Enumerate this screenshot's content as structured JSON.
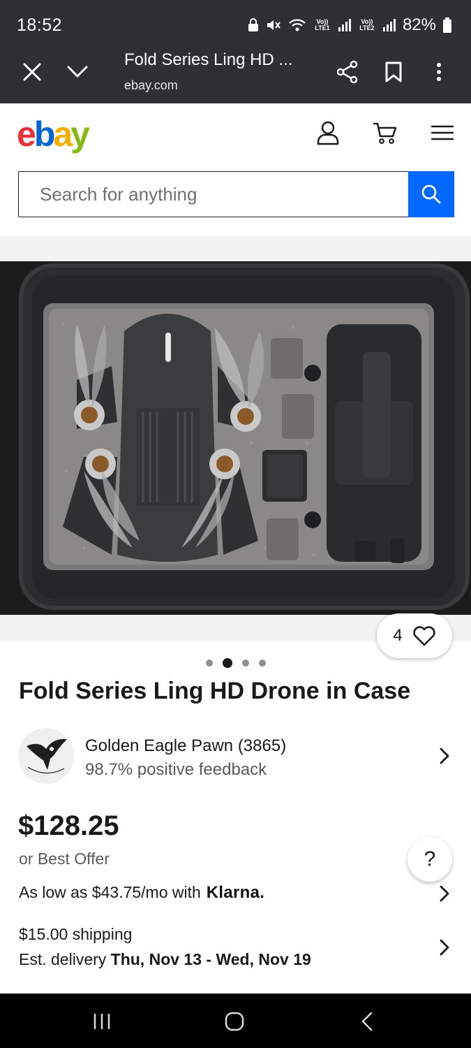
{
  "status_bar": {
    "time": "18:52",
    "network1": "Vo)) LTE1",
    "network2": "Vo)) LTE2",
    "battery": "82%"
  },
  "browser": {
    "title": "Fold Series Ling HD ...",
    "url": "ebay.com"
  },
  "header": {
    "logo": {
      "e": "e",
      "b": "b",
      "a": "a",
      "y": "y"
    },
    "search_placeholder": "Search for anything"
  },
  "item": {
    "watch_count": "4",
    "carousel": {
      "total": 4,
      "active_index": 1
    },
    "title": "Fold Series Ling HD Drone in Case",
    "seller": {
      "name": "Golden Eagle Pawn (3865)",
      "feedback": "98.7% positive feedback",
      "avatar_text": "Golden Eagle Pawn"
    },
    "price": "$128.25",
    "best_offer": "or Best Offer",
    "klarna_text": "As low as $43.75/mo with",
    "klarna_brand": "Klarna.",
    "shipping": "$15.00 shipping",
    "delivery_prefix": "Est. delivery",
    "delivery_dates": "Thu, Nov 13 - Wed, Nov 19"
  },
  "help_label": "?",
  "colors": {
    "chrome_bg": "#2f3033",
    "search_blue": "#0068ff",
    "ebay_red": "#e53238",
    "ebay_blue": "#0064d2",
    "ebay_yellow": "#f5af02",
    "ebay_green": "#86b817"
  }
}
